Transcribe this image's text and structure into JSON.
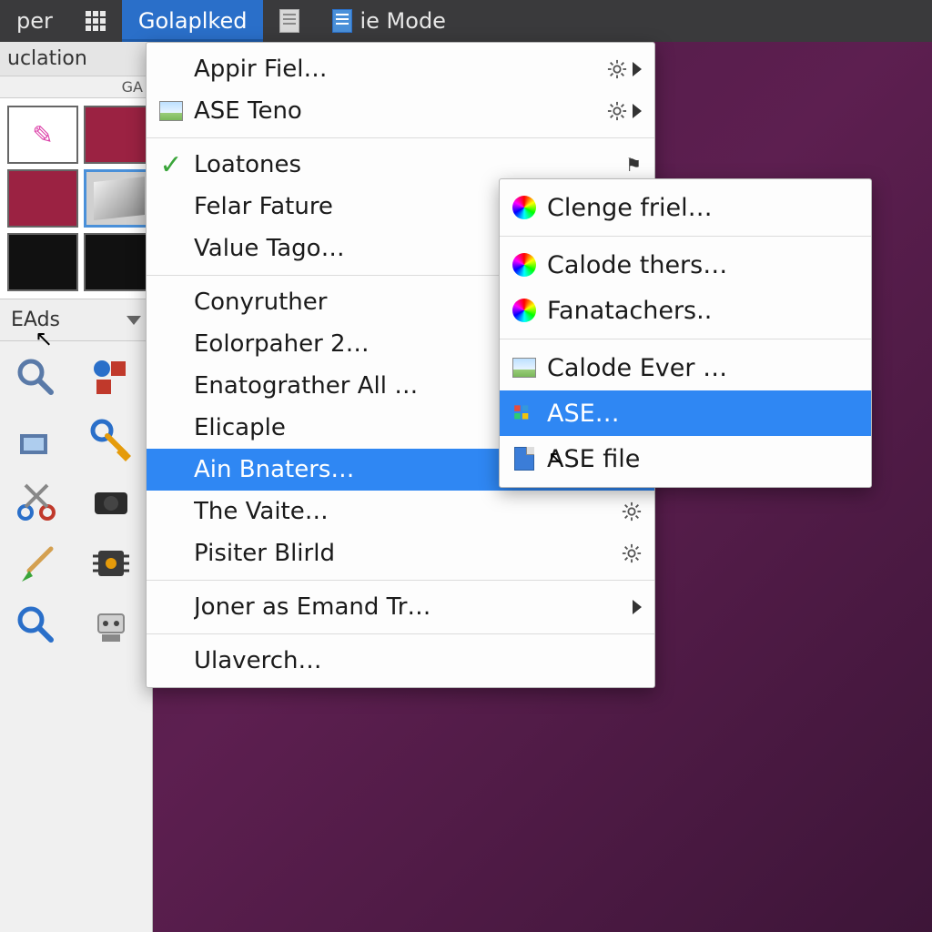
{
  "menubar": {
    "items": [
      {
        "label": "per",
        "icon": "none"
      },
      {
        "label": "",
        "icon": "grid"
      },
      {
        "label": "Golaplked",
        "icon": "none",
        "active": true
      },
      {
        "label": "",
        "icon": "doc"
      },
      {
        "label": "ie Mode",
        "icon": "doc-blue"
      }
    ]
  },
  "sidebar": {
    "panel_title": "uclation",
    "panel_sub": "GA",
    "tool_header": "EAds"
  },
  "menu": {
    "groups": [
      [
        {
          "label": "Appir Fiel…",
          "icon": "",
          "tail": "gear-arrow"
        },
        {
          "label": "ASE Teno",
          "icon": "img-thumb",
          "tail": "gear-arrow"
        }
      ],
      [
        {
          "label": "Loatones",
          "icon": "check",
          "tail": "flag"
        },
        {
          "label": "Felar Fature",
          "icon": "",
          "tail": ""
        },
        {
          "label": "Value Tago…",
          "icon": "",
          "tail": ""
        }
      ],
      [
        {
          "label": "Conyruther",
          "icon": "",
          "tail": ""
        },
        {
          "label": "Eolorpaher 2…",
          "icon": "",
          "tail": ""
        },
        {
          "label": "Enatograther All …",
          "icon": "",
          "tail": ""
        },
        {
          "label": "Elicaple",
          "icon": "",
          "tail": ""
        },
        {
          "label": "Ain Bnaters…",
          "icon": "",
          "tail": "gear-arrow",
          "highlight": true
        },
        {
          "label": "The Vaite…",
          "icon": "",
          "tail": "gear"
        },
        {
          "label": "Pisiter Blirld",
          "icon": "",
          "tail": "gear"
        }
      ],
      [
        {
          "label": "Joner as Emand Tr…",
          "icon": "",
          "tail": "arrow"
        }
      ],
      [
        {
          "label": "Ulaverch…",
          "icon": "",
          "tail": ""
        }
      ]
    ]
  },
  "submenu": {
    "groups": [
      [
        {
          "label": "Clenge friel…",
          "icon": "colorwheel"
        }
      ],
      [
        {
          "label": "Calode thers…",
          "icon": "colorwheel"
        },
        {
          "label": "Fanatachers..",
          "icon": "colorwheel"
        }
      ],
      [
        {
          "label": "Calode Ever …",
          "icon": "img-thumb"
        },
        {
          "label": "ASE…",
          "icon": "palette",
          "highlight": true
        },
        {
          "label": "ASE file",
          "icon": "file-blue"
        }
      ]
    ]
  }
}
